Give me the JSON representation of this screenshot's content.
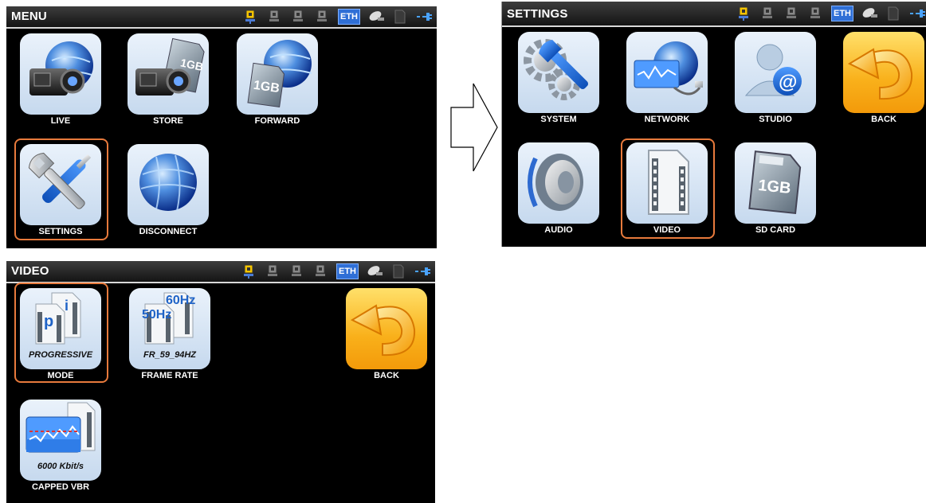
{
  "status_bar": {
    "eth_label": "ETH",
    "icons": [
      "network-port-active-icon",
      "network-port-icon",
      "network-port-icon",
      "network-port-icon",
      "eth-badge",
      "satellite-icon",
      "sd-card-icon",
      "power-plug-icon"
    ]
  },
  "screens": {
    "menu": {
      "title": "MENU",
      "items": [
        {
          "label": "LIVE",
          "icon": "camera-globe-icon"
        },
        {
          "label": "STORE",
          "icon": "camera-sdcard-icon"
        },
        {
          "label": "FORWARD",
          "icon": "sdcard-globe-icon"
        },
        {
          "label": "SETTINGS",
          "icon": "wrench-screwdriver-icon",
          "selected": true
        },
        {
          "label": "DISCONNECT",
          "icon": "globe-icon"
        }
      ]
    },
    "settings": {
      "title": "SETTINGS",
      "items": [
        {
          "label": "SYSTEM",
          "icon": "gears-wrench-icon"
        },
        {
          "label": "NETWORK",
          "icon": "network-globe-icon"
        },
        {
          "label": "STUDIO",
          "icon": "user-at-icon"
        },
        {
          "label": "BACK",
          "icon": "back-arrow-icon"
        },
        {
          "label": "AUDIO",
          "icon": "speaker-icon"
        },
        {
          "label": "VIDEO",
          "icon": "film-icon",
          "selected": true
        },
        {
          "label": "SD CARD",
          "icon": "sd-card-icon"
        }
      ]
    },
    "video": {
      "title": "VIDEO",
      "items": [
        {
          "label": "MODE",
          "value": "PROGRESSIVE",
          "icon_text_p": "p",
          "icon_text_i": "i",
          "icon": "progressive-interlaced-icon",
          "selected": true
        },
        {
          "label": "FRAME RATE",
          "value": "FR_59_94HZ",
          "icon_text_a": "50Hz",
          "icon_text_b": "60Hz",
          "icon": "frame-rate-icon"
        },
        {
          "label": "BACK",
          "icon": "back-arrow-icon"
        },
        {
          "label": "CAPPED VBR",
          "value": "6000 Kbit/s",
          "icon": "bitrate-graph-icon"
        }
      ]
    }
  },
  "colors": {
    "screen_bg": "#000000",
    "selection_outline": "#e87a3c",
    "eth_badge": "#2f6fd6",
    "tile_bg": "#c6d9ee",
    "back_tile_bg": "#f9b01a"
  },
  "sd_card_text": "1GB"
}
